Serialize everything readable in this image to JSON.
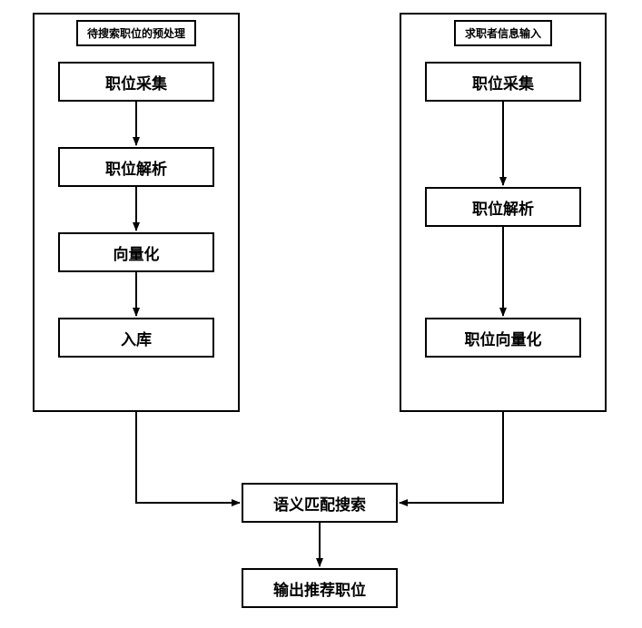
{
  "chart_data": {
    "type": "flowchart",
    "groups": [
      {
        "id": "left",
        "title": "待搜索职位的预处理",
        "nodes": [
          {
            "id": "l1",
            "label": "职位采集"
          },
          {
            "id": "l2",
            "label": "职位解析"
          },
          {
            "id": "l3",
            "label": "向量化"
          },
          {
            "id": "l4",
            "label": "入库"
          }
        ],
        "edges": [
          [
            "l1",
            "l2"
          ],
          [
            "l2",
            "l3"
          ],
          [
            "l3",
            "l4"
          ]
        ]
      },
      {
        "id": "right",
        "title": "求职者信息输入",
        "nodes": [
          {
            "id": "r1",
            "label": "职位采集"
          },
          {
            "id": "r2",
            "label": "职位解析"
          },
          {
            "id": "r3",
            "label": "职位向量化"
          }
        ],
        "edges": [
          [
            "r1",
            "r2"
          ],
          [
            "r2",
            "r3"
          ]
        ]
      }
    ],
    "shared_nodes": [
      {
        "id": "s1",
        "label": "语义匹配搜索"
      },
      {
        "id": "s2",
        "label": "输出推荐职位"
      }
    ],
    "shared_edges": [
      [
        "left",
        "s1"
      ],
      [
        "right",
        "s1"
      ],
      [
        "s1",
        "s2"
      ]
    ]
  }
}
